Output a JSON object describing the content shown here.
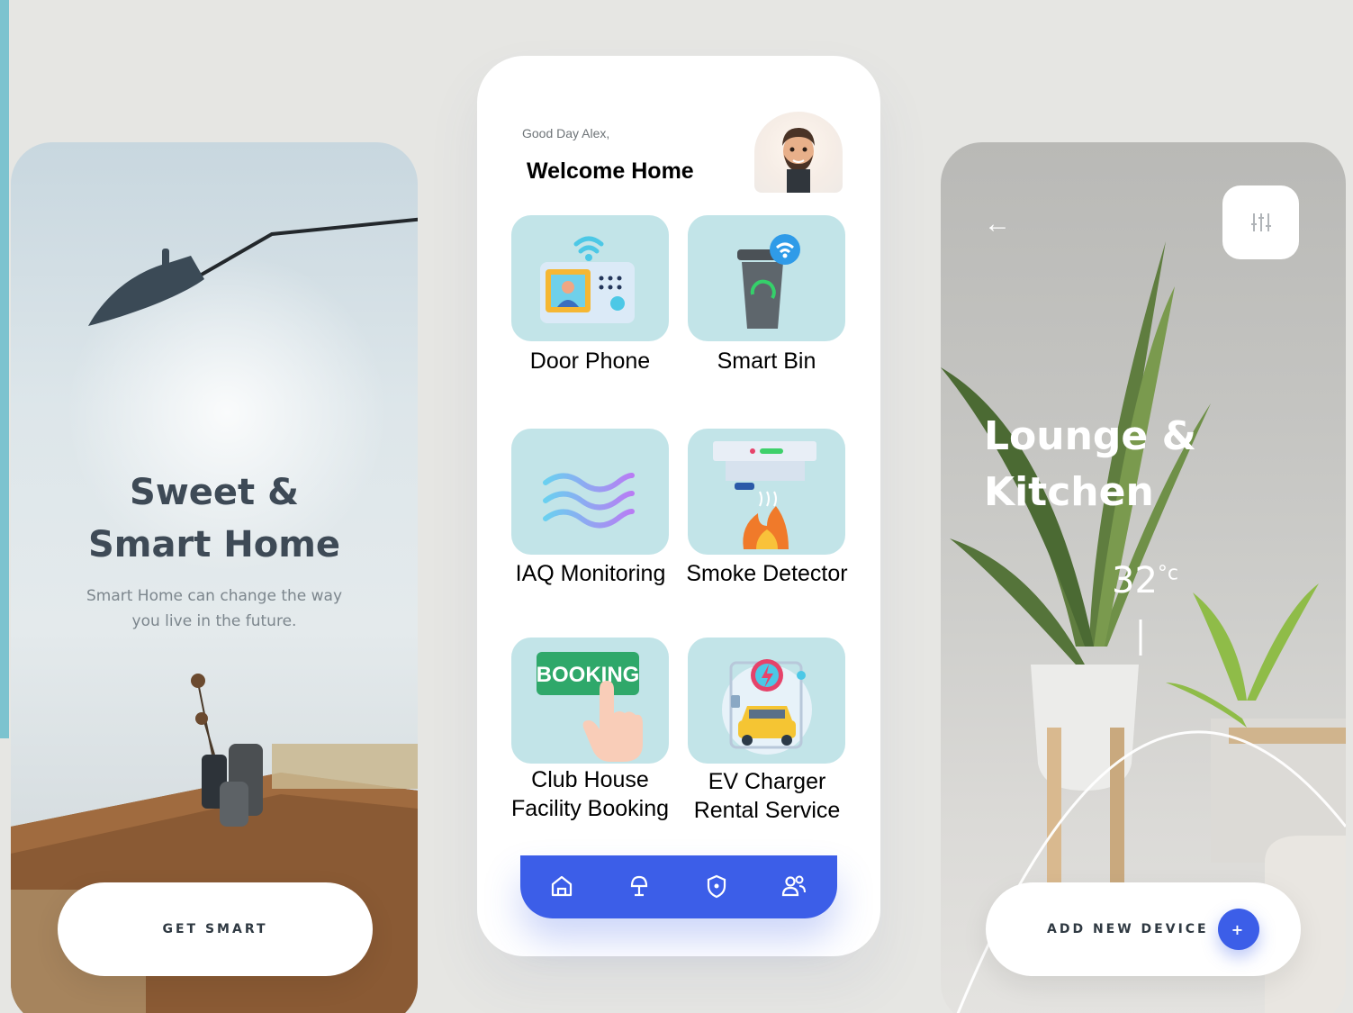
{
  "left_screen": {
    "title_line1": "Sweet &",
    "title_line2": "Smart Home",
    "subtitle_line1": "Smart Home can change the way",
    "subtitle_line2": "you live in the future.",
    "button_label": "GET SMART"
  },
  "center_screen": {
    "greeting": "Good Day Alex,",
    "welcome": "Welcome Home",
    "tiles": [
      {
        "label": "Door Phone",
        "icon": "door-phone-icon"
      },
      {
        "label": "Smart Bin",
        "icon": "smart-bin-icon"
      },
      {
        "label": "IAQ Monitoring",
        "icon": "air-waves-icon"
      },
      {
        "label": "Smoke Detector",
        "icon": "smoke-detector-icon"
      },
      {
        "label_line1": "Club House",
        "label_line2": "Facility Booking",
        "icon": "booking-icon",
        "badge": "BOOKING"
      },
      {
        "label_line1": "EV Charger",
        "label_line2": "Rental Service",
        "icon": "ev-charger-icon"
      }
    ],
    "nav": [
      "home-icon",
      "lamp-icon",
      "shield-icon",
      "users-icon"
    ]
  },
  "right_screen": {
    "title_line1": "Lounge &",
    "title_line2": "Kitchen",
    "temperature": "32",
    "temperature_unit": "°c",
    "button_label": "ADD NEW DEVICE",
    "plus": "+"
  },
  "colors": {
    "accent_blue": "#3c5ee8",
    "tile_bg": "#c2e4e8",
    "page_bg": "#e6e6e3",
    "strip": "#7cc3cf"
  }
}
